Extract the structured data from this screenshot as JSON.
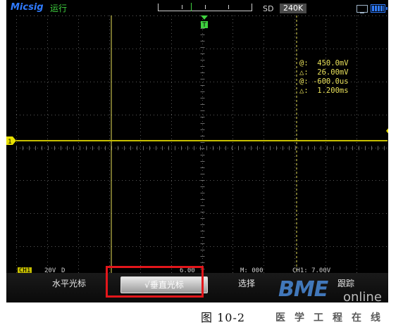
{
  "status_bar": {
    "brand": "Micsig",
    "run_state": "运行",
    "sample_mode": "SD",
    "memory_depth": "240K"
  },
  "cursor_readout": {
    "v1": "@:  450.0mV",
    "v_delta": "△:  26.00mV",
    "t1": "@: -600.0us",
    "t_delta": "△:  1.200ms"
  },
  "info_bar": {
    "ch": "CH1",
    "volts": "20V",
    "mode": "D",
    "time": "6.00",
    "scale": "M: 000",
    "trig": "CH1: 7.00V"
  },
  "softkeys": [
    {
      "label": "水平光标"
    },
    {
      "label": "√垂直光标"
    },
    {
      "label": "选择"
    },
    {
      "label": "跟踪"
    }
  ],
  "caption": "图 10-2",
  "watermark": {
    "logo": "BME",
    "suffix": "online",
    "text": "医学工程在线"
  },
  "markers": {
    "channel": "1",
    "trigger": "T"
  },
  "colors": {
    "trace": "#c8c000",
    "grid": "#5a5a5a",
    "cursor": "#e8e05a",
    "highlight": "#e3161b"
  }
}
